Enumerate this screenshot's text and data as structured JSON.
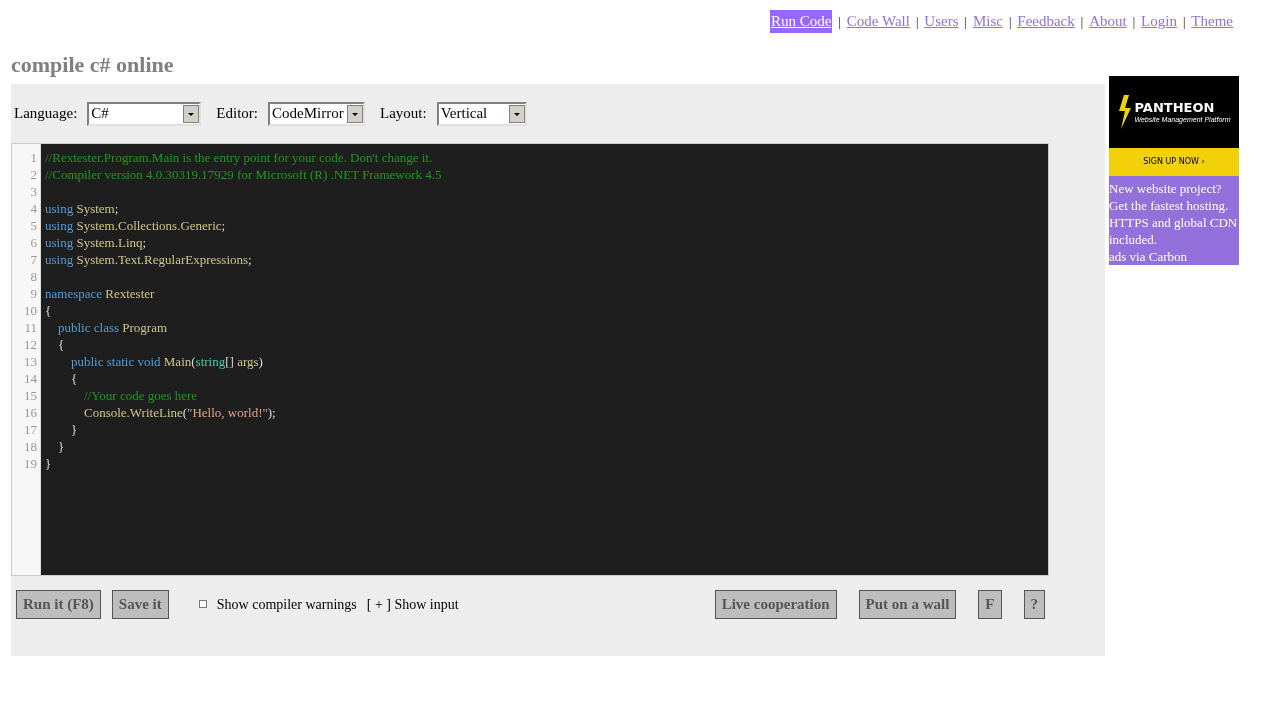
{
  "nav": [
    {
      "label": "Run Code",
      "selected": true
    },
    {
      "label": "Code Wall",
      "selected": false
    },
    {
      "label": "Users",
      "selected": false
    },
    {
      "label": "Misc",
      "selected": false
    },
    {
      "label": "Feedback",
      "selected": false
    },
    {
      "label": "About",
      "selected": false
    },
    {
      "label": "Login",
      "selected": false
    },
    {
      "label": "Theme",
      "selected": false
    }
  ],
  "nav_separator": "|",
  "title": "compile c# online",
  "options": [
    {
      "label": "Language:",
      "value": "C#"
    },
    {
      "label": "Editor:",
      "value": "CodeMirror"
    },
    {
      "label": "Layout:",
      "value": "Vertical"
    }
  ],
  "editor": {
    "lines": [
      {
        "number": "1",
        "tokens": [
          {
            "kind": "comment",
            "text": "//Rextester.Program.Main is the entry point for your code. Don't change it."
          }
        ]
      },
      {
        "number": "2",
        "tokens": [
          {
            "kind": "comment",
            "text": "//Compiler version 4.0.30319.17929 for Microsoft (R) .NET Framework 4.5"
          }
        ]
      },
      {
        "number": "3"
      },
      {
        "number": "4",
        "tokens": [
          {
            "kind": "keyword",
            "text": "using "
          },
          {
            "kind": "ident",
            "text": "System"
          },
          {
            "kind": "plain",
            "text": ";"
          }
        ]
      },
      {
        "number": "5",
        "tokens": [
          {
            "kind": "keyword",
            "text": "using "
          },
          {
            "kind": "ident",
            "text": "System.Collections.Generic"
          },
          {
            "kind": "plain",
            "text": ";"
          }
        ]
      },
      {
        "number": "6",
        "tokens": [
          {
            "kind": "keyword",
            "text": "using "
          },
          {
            "kind": "ident",
            "text": "System.Linq"
          },
          {
            "kind": "plain",
            "text": ";"
          }
        ]
      },
      {
        "number": "7",
        "tokens": [
          {
            "kind": "keyword",
            "text": "using "
          },
          {
            "kind": "ident",
            "text": "System.Text.RegularExpressions"
          },
          {
            "kind": "plain",
            "text": ";"
          }
        ]
      },
      {
        "number": "8"
      },
      {
        "number": "9",
        "tokens": [
          {
            "kind": "keyword",
            "text": "namespace "
          },
          {
            "kind": "ident",
            "text": "Rextester"
          }
        ]
      },
      {
        "number": "10",
        "tokens": [
          {
            "kind": "plain",
            "text": "{"
          }
        ]
      },
      {
        "number": "11",
        "tokens": [
          {
            "kind": "keyword",
            "text": "    public class "
          },
          {
            "kind": "ident",
            "text": "Program"
          }
        ]
      },
      {
        "number": "12",
        "tokens": [
          {
            "kind": "plain",
            "text": "    {"
          }
        ]
      },
      {
        "number": "13",
        "tokens": [
          {
            "kind": "keyword",
            "text": "        public static void "
          },
          {
            "kind": "ident",
            "text": "Main"
          },
          {
            "kind": "plain",
            "text": "("
          },
          {
            "kind": "builtin",
            "text": "string"
          },
          {
            "kind": "plain",
            "text": "[] "
          },
          {
            "kind": "ident",
            "text": "args"
          },
          {
            "kind": "plain",
            "text": ")"
          }
        ]
      },
      {
        "number": "14",
        "tokens": [
          {
            "kind": "plain",
            "text": "        {"
          }
        ]
      },
      {
        "number": "15",
        "tokens": [
          {
            "kind": "comment",
            "text": "            //Your code goes here"
          }
        ]
      },
      {
        "number": "16",
        "tokens": [
          {
            "kind": "ident",
            "text": "            Console.WriteLine"
          },
          {
            "kind": "plain",
            "text": "("
          },
          {
            "kind": "string",
            "text": "\"Hello, world!\""
          },
          {
            "kind": "plain",
            "text": ");"
          }
        ]
      },
      {
        "number": "17",
        "tokens": [
          {
            "kind": "plain",
            "text": "        }"
          }
        ]
      },
      {
        "number": "18",
        "tokens": [
          {
            "kind": "plain",
            "text": "    }"
          }
        ]
      },
      {
        "number": "19",
        "tokens": [
          {
            "kind": "plain",
            "text": "}"
          }
        ]
      }
    ]
  },
  "actions_left": [
    "Run it (F8)",
    "Save it"
  ],
  "warnings": {
    "label": "Show compiler warnings",
    "checked": false
  },
  "show_input": "[ + ] Show input",
  "actions_right": [
    "Live cooperation",
    "Put on a wall",
    "F",
    "?"
  ],
  "ad": {
    "brand": "PANTHEON",
    "tagline": "Website Management Platform",
    "cta": "SIGN UP NOW ›",
    "text": "New website project? Get the fastest hosting. HTTPS and global CDN included.",
    "via": "ads via Carbon"
  }
}
